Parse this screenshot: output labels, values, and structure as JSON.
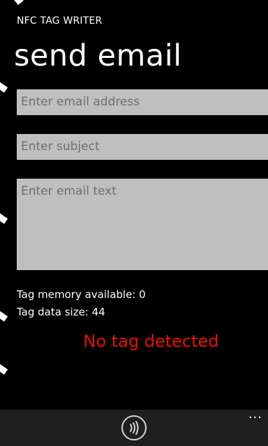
{
  "app": {
    "title": "NFC TAG WRITER",
    "page_title": "send email"
  },
  "form": {
    "email_placeholder": "Enter email address",
    "subject_placeholder": "Enter subject",
    "body_placeholder": "Enter email text"
  },
  "info": {
    "memory_label": "Tag memory available: 0",
    "size_label": "Tag data size: 44"
  },
  "status": {
    "text": "No tag detected",
    "color": "#e51400"
  },
  "appbar": {
    "button_icon": "nfc-icon",
    "more_label": "..."
  }
}
